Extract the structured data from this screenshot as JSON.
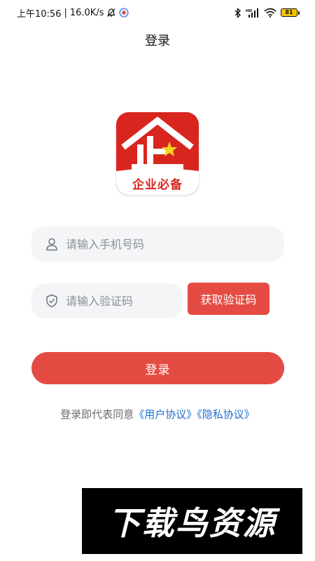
{
  "status_bar": {
    "time": "上午10:56",
    "separator": "|",
    "network_speed": "16.0K/s",
    "battery": "81",
    "icons": [
      "bell-off-icon",
      "app-notification-icon",
      "bluetooth-icon",
      "hd-signal-icon",
      "wifi-icon",
      "battery-icon"
    ]
  },
  "header": {
    "title": "登录"
  },
  "logo": {
    "caption": "企业必备",
    "brand_color": "#d8261f"
  },
  "form": {
    "phone_placeholder": "请输入手机号码",
    "code_placeholder": "请输入验证码",
    "get_code_label": "获取验证码",
    "login_label": "登录"
  },
  "agreement": {
    "prefix": "登录即代表同意",
    "user_agreement": "《用户协议》",
    "privacy_policy": "《隐私协议》"
  },
  "watermark": {
    "text": "下载鸟资源"
  },
  "colors": {
    "accent": "#e44c43",
    "link": "#1b6fd0",
    "input_bg": "#f4f5f7"
  }
}
